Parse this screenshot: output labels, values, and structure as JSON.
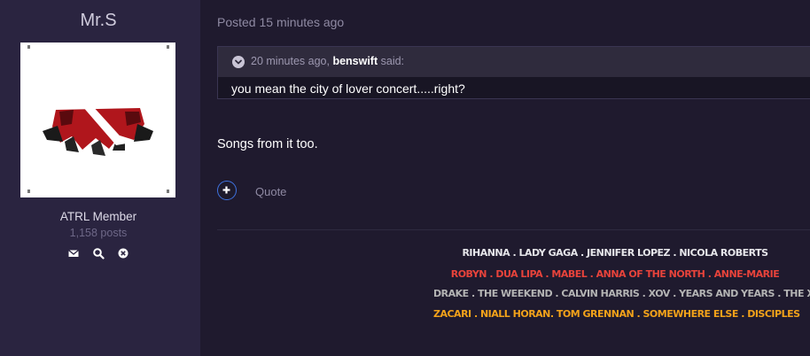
{
  "author": {
    "name": "Mr.S",
    "title": "ATRL Member",
    "posts": "1,158 posts",
    "icons": [
      "envelope-icon",
      "search-icon",
      "close-circle-icon"
    ]
  },
  "post": {
    "posted": "Posted 15 minutes ago",
    "quote": {
      "time": "20 minutes ago,",
      "author": "benswift",
      "said": "said:",
      "text": "you mean the city of lover concert.....right?"
    },
    "body": "Songs from it too.",
    "quote_link": "Quote"
  },
  "signature": {
    "lines": [
      {
        "text": "RIHANNA . LADY GAGA . JENNIFER LOPEZ . NICOLA ROBERTS",
        "color": "#e6e6ea"
      },
      {
        "text": "ROBYN . DUA LIPA . MABEL . ANNA OF THE NORTH . ANNE-MARIE",
        "color": "#e8433b"
      },
      {
        "text": "DRAKE . THE WEEKEND . CALVIN HARRIS . XOV . YEARS AND YEARS . THE XX",
        "color": "#b4b4b4"
      },
      {
        "text": "ZACARI . NIALL HORAN. TOM GRENNAN . SOMEWHERE ELSE . DISCIPLES",
        "color": "#f2a21a"
      }
    ]
  },
  "colors": {
    "background": "#1f1a2e",
    "author_panel": "#2a2440",
    "accent": "#3f72e0"
  }
}
